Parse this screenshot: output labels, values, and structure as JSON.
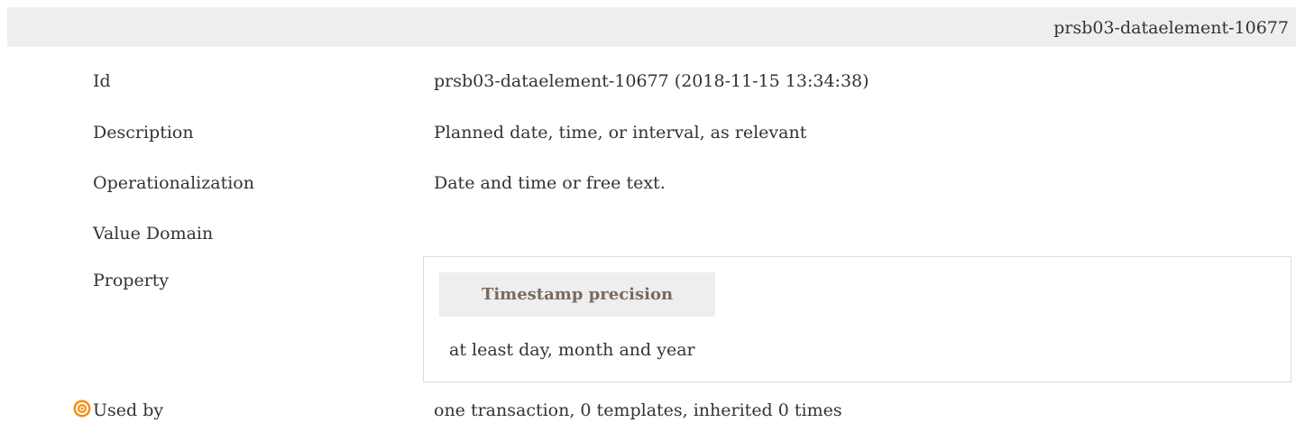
{
  "header": {
    "id": "prsb03-dataelement-10677"
  },
  "rows": {
    "id": {
      "label": "Id",
      "value": "prsb03-dataelement-10677 (2018-11-15 13:34:38)"
    },
    "description": {
      "label": "Description",
      "value": "Planned date, time, or interval, as relevant"
    },
    "operationalization": {
      "label": "Operationalization",
      "value": "Date and time or free text."
    },
    "value_domain": {
      "label": "Value Domain"
    },
    "property": {
      "label": "Property",
      "name": "Timestamp precision",
      "value": "at least day, month and year"
    },
    "used_by": {
      "label": "Used by",
      "icon": "target-icon",
      "value": "one transaction, 0 templates, inherited 0 times"
    }
  },
  "colors": {
    "header_bg": "#eeeeee",
    "property_name_text": "#7a6a5c",
    "icon_orange": "#f0900a"
  }
}
